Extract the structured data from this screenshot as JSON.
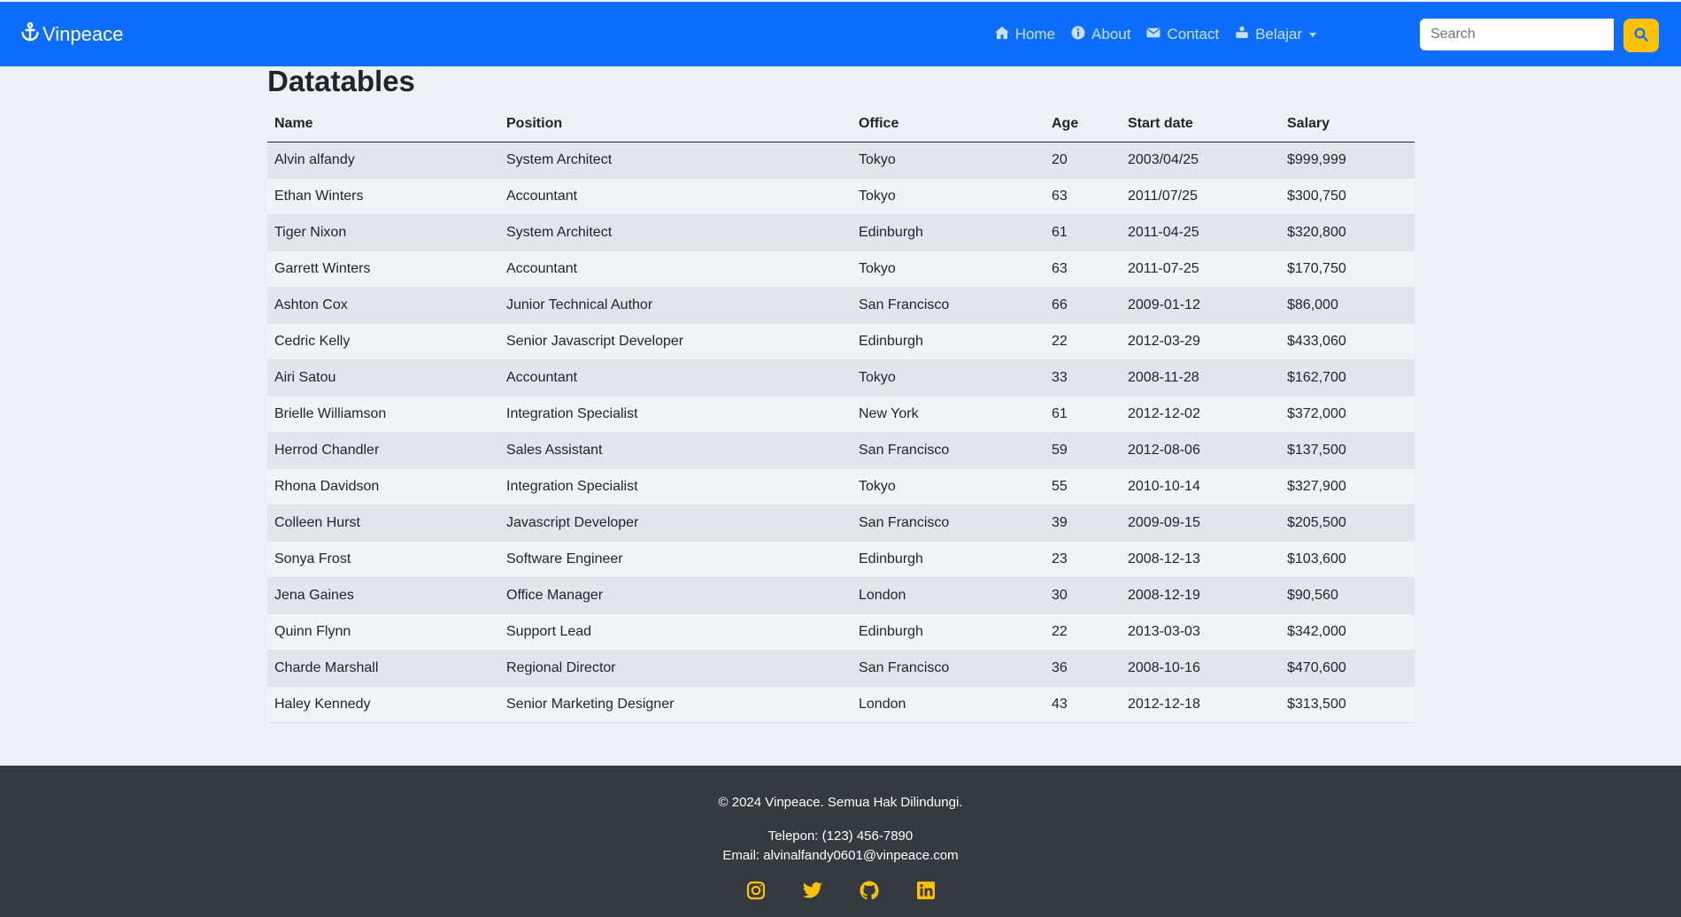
{
  "brand": {
    "name": "Vinpeace"
  },
  "nav": {
    "home": "Home",
    "about": "About",
    "contact": "Contact",
    "belajar": "Belajar"
  },
  "search": {
    "placeholder": "Search",
    "value": ""
  },
  "page": {
    "title": "Datatables"
  },
  "table": {
    "columns": [
      "Name",
      "Position",
      "Office",
      "Age",
      "Start date",
      "Salary"
    ],
    "rows": [
      [
        "Alvin alfandy",
        "System Architect",
        "Tokyo",
        "20",
        "2003/04/25",
        "$999,999"
      ],
      [
        "Ethan Winters",
        "Accountant",
        "Tokyo",
        "63",
        "2011/07/25",
        "$300,750"
      ],
      [
        "Tiger Nixon",
        "System Architect",
        "Edinburgh",
        "61",
        "2011-04-25",
        "$320,800"
      ],
      [
        "Garrett Winters",
        "Accountant",
        "Tokyo",
        "63",
        "2011-07-25",
        "$170,750"
      ],
      [
        "Ashton Cox",
        "Junior Technical Author",
        "San Francisco",
        "66",
        "2009-01-12",
        "$86,000"
      ],
      [
        "Cedric Kelly",
        "Senior Javascript Developer",
        "Edinburgh",
        "22",
        "2012-03-29",
        "$433,060"
      ],
      [
        "Airi Satou",
        "Accountant",
        "Tokyo",
        "33",
        "2008-11-28",
        "$162,700"
      ],
      [
        "Brielle Williamson",
        "Integration Specialist",
        "New York",
        "61",
        "2012-12-02",
        "$372,000"
      ],
      [
        "Herrod Chandler",
        "Sales Assistant",
        "San Francisco",
        "59",
        "2012-08-06",
        "$137,500"
      ],
      [
        "Rhona Davidson",
        "Integration Specialist",
        "Tokyo",
        "55",
        "2010-10-14",
        "$327,900"
      ],
      [
        "Colleen Hurst",
        "Javascript Developer",
        "San Francisco",
        "39",
        "2009-09-15",
        "$205,500"
      ],
      [
        "Sonya Frost",
        "Software Engineer",
        "Edinburgh",
        "23",
        "2008-12-13",
        "$103,600"
      ],
      [
        "Jena Gaines",
        "Office Manager",
        "London",
        "30",
        "2008-12-19",
        "$90,560"
      ],
      [
        "Quinn Flynn",
        "Support Lead",
        "Edinburgh",
        "22",
        "2013-03-03",
        "$342,000"
      ],
      [
        "Charde Marshall",
        "Regional Director",
        "San Francisco",
        "36",
        "2008-10-16",
        "$470,600"
      ],
      [
        "Haley Kennedy",
        "Senior Marketing Designer",
        "London",
        "43",
        "2012-12-18",
        "$313,500"
      ]
    ]
  },
  "footer": {
    "copyright": "© 2024 Vinpeace. Semua Hak Dilindungi.",
    "phone": "Telepon: (123) 456-7890",
    "email": "Email: alvinalfandy0601@vinpeace.com",
    "socials": [
      "instagram-icon",
      "twitter-icon",
      "github-icon",
      "linkedin-icon"
    ]
  },
  "colors": {
    "navbar": "#0d6efd",
    "accent": "#ffc107",
    "footer": "#343a40",
    "background": "#edf1f6"
  }
}
